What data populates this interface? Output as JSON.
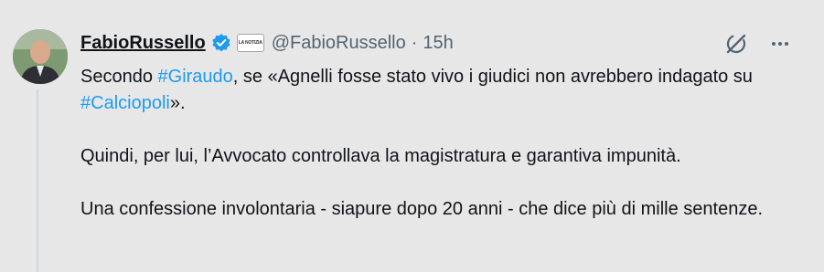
{
  "author": {
    "name": "FabioRussello",
    "handle": "@FabioRussello",
    "dot": "·",
    "time": "15h",
    "affiliation_badge": "LA NOTIZIA"
  },
  "tweet": {
    "p1_before": "Secondo ",
    "p1_tag1": "#Giraudo",
    "p1_mid": ", se «Agnelli fosse stato vivo i giudici non avrebbero indagato su ",
    "p1_tag2": "#Calciopoli",
    "p1_after": "».",
    "p2": "Quindi, per lui, l’Avvocato controllava la magistratura e garantiva impunità.",
    "p3": "Una confessione involontaria - siapure dopo 20 anni - che dice più di mille sentenze."
  },
  "colors": {
    "background": "#e7e7e7",
    "link": "#1d9bf0",
    "secondary_text": "#536471",
    "verified_badge": "#1d9bf0"
  },
  "icons": {
    "verified": "verified-badge-icon",
    "grok": "grok-icon",
    "more": "more-options-icon"
  }
}
